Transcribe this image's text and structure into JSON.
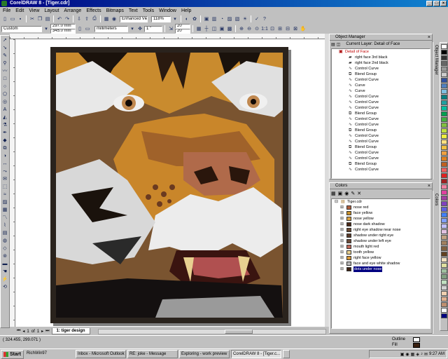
{
  "window": {
    "title": "CorelDRAW 8 - [Tiger.cdr]"
  },
  "menu": [
    "File",
    "Edit",
    "View",
    "Layout",
    "Arrange",
    "Effects",
    "Bitmaps",
    "Text",
    "Tools",
    "Window",
    "Help"
  ],
  "standard_toolbar": {
    "view_mode": "Enhanced View",
    "zoom": "118%"
  },
  "property_bar": {
    "page_size": "Custom",
    "width": "297.0 mm",
    "height": "345.0 mm",
    "units": "millimeters",
    "nudge": "1 \"",
    "dup_x": "20 \"",
    "dup_y": "20 \""
  },
  "page_nav": {
    "current": "1",
    "of_label": "of",
    "total": "1",
    "tab_label": "1: tiger design"
  },
  "object_manager": {
    "title": "Object Manager",
    "current_layer": "Current Layer: Detail of Face",
    "root": "Detail of Face",
    "items": [
      "right face 3rd black",
      "right face 2nd black",
      "Control Curve",
      "Blend Group",
      "Control Curve",
      "Curve",
      "Curve",
      "Control Curve",
      "Control Curve",
      "Control Curve",
      "Blend Group",
      "Control Curve",
      "Control Curve",
      "Blend Group",
      "Control Curve",
      "Control Curve",
      "Blend Group",
      "Control Curve",
      "Control Curve",
      "Blend Group",
      "Control Curve"
    ],
    "side_label": "Object Manager"
  },
  "colors_docker": {
    "title": "Colors",
    "root": "Tiger.cdr",
    "items": [
      {
        "name": "nose red",
        "color": "#b06040"
      },
      {
        "name": "face yellow",
        "color": "#c8902c"
      },
      {
        "name": "nose yellow",
        "color": "#d8a040"
      },
      {
        "name": "nose dark shadow",
        "color": "#4a2818"
      },
      {
        "name": "right eye shadow near nose",
        "color": "#6a4830"
      },
      {
        "name": "shadow under right eye",
        "color": "#5a3a28"
      },
      {
        "name": "shadow under left eye",
        "color": "#6a4a38"
      },
      {
        "name": "mouth light red",
        "color": "#c06858"
      },
      {
        "name": "tooth yellow",
        "color": "#e8d090"
      },
      {
        "name": "right face yellow",
        "color": "#d89838"
      },
      {
        "name": "face and eye white shadow",
        "color": "#b8b8b8"
      },
      {
        "name": "dots under nose",
        "color": "#3a2010"
      }
    ],
    "selected_index": 11,
    "side_label": "Colors"
  },
  "status": {
    "coords": "( 324.455, 299.071 )",
    "outline_label": "Outline",
    "fill_label": "Fill"
  },
  "taskbar": {
    "start": "Start",
    "items": [
      "RichWin97",
      "Inbox - Microsoft Outlook",
      "RE: joke - Message",
      "Exploring - work preview",
      "CorelDRAW 8 - [Tiger.c...",
      ""
    ],
    "active_index": 4,
    "clock": "9:27 AM"
  },
  "palette": [
    "#ffffff",
    "#000000",
    "#333333",
    "#666666",
    "#999999",
    "#cccccc",
    "#3050a0",
    "#5080c0",
    "#80c0e0",
    "#008080",
    "#20a0a0",
    "#00c0a0",
    "#00a050",
    "#40b040",
    "#80c040",
    "#c0e040",
    "#f0f040",
    "#ffe080",
    "#f0c040",
    "#f0a040",
    "#e08020",
    "#c06020",
    "#f06060",
    "#e02020",
    "#a02020",
    "#f080a0",
    "#e040a0",
    "#a040a0",
    "#8040c0",
    "#6060e0",
    "#4080ff",
    "#80a0ff",
    "#c0c0ff",
    "#e0c0e0",
    "#c0a080",
    "#a08060",
    "#806040",
    "#604020",
    "#f0e0c0",
    "#e0e0a0",
    "#a0c0a0",
    "#80a080",
    "#c0e0c0",
    "#d0d0d0",
    "#f0d0b0",
    "#e0b090",
    "#c09070",
    "#ffffff",
    "#000080"
  ]
}
